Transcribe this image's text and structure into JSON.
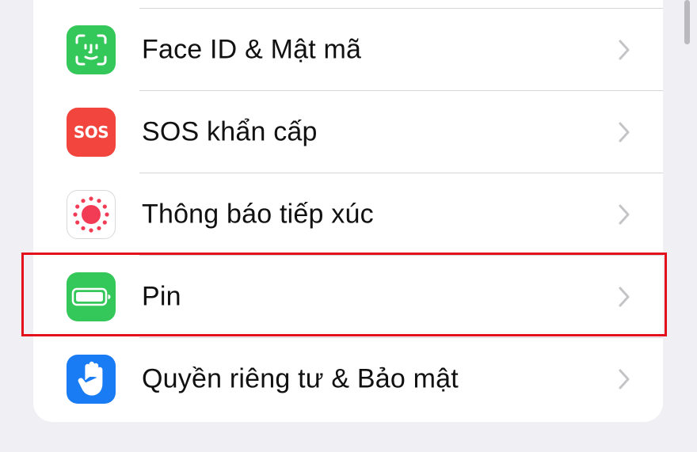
{
  "settings": {
    "items": [
      {
        "label": "Face ID & Mật mã",
        "icon": "face-id-icon",
        "icon_color": "#34c759"
      },
      {
        "label": "SOS khẩn cấp",
        "icon": "sos-icon",
        "icon_text": "SOS",
        "icon_color": "#f2453d"
      },
      {
        "label": "Thông báo tiếp xúc",
        "icon": "exposure-notification-icon",
        "icon_color": "#ffffff"
      },
      {
        "label": "Pin",
        "icon": "battery-icon",
        "icon_color": "#34c759",
        "highlighted": true
      },
      {
        "label": "Quyền riêng tư & Bảo mật",
        "icon": "hand-icon",
        "icon_color": "#1a7cf5"
      }
    ]
  },
  "highlight_color": "#e3101c"
}
